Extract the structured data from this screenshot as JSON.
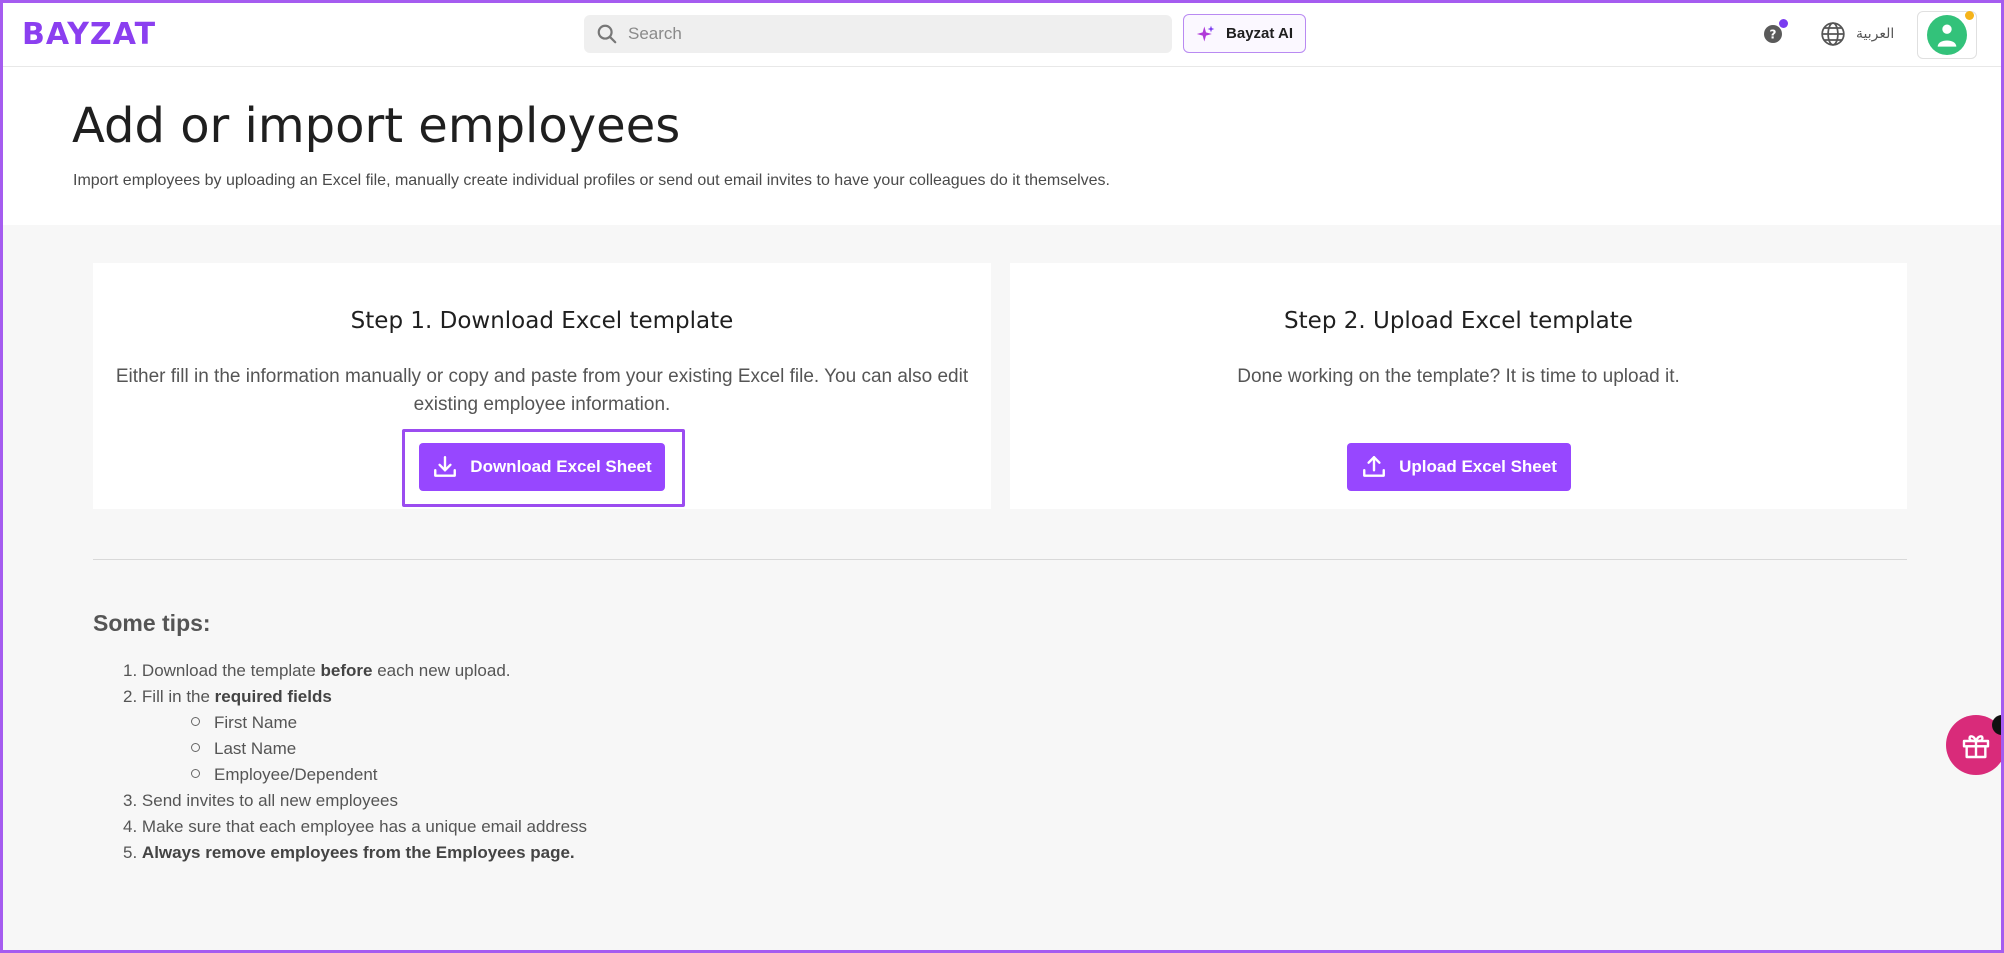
{
  "topbar": {
    "logo": "BAYZAT",
    "search_placeholder": "Search",
    "ai_button": "Bayzat AI",
    "language": "العربية"
  },
  "header": {
    "title": "Add or import employees",
    "subtitle": "Import employees by uploading an Excel file, manually create individual profiles or send out email invites to have your colleagues do it themselves."
  },
  "step1": {
    "title": "Step 1. Download Excel template",
    "description": "Either fill in the information manually or copy and paste from your existing Excel file. You can also edit existing employee information.",
    "button": "Download Excel Sheet"
  },
  "step2": {
    "title": "Step 2. Upload Excel template",
    "description": "Done working on the template? It is time to upload it.",
    "button": "Upload Excel Sheet"
  },
  "tips": {
    "title": "Some tips:",
    "t1_num": "1.",
    "t1_pre": "Download the template ",
    "t1_bold": "before",
    "t1_post": " each new upload.",
    "t2_num": "2.",
    "t2_pre": "Fill in the ",
    "t2_bold": "required fields",
    "fields": [
      "First Name",
      "Last Name",
      "Employee/Dependent"
    ],
    "t3_num": "3.",
    "t3": "Send invites to all new employees",
    "t4_num": "4.",
    "t4": "Make sure that each employee has a unique email address",
    "t5_num": "5.",
    "t5_bold": "Always remove employees from the Employees page."
  },
  "colors": {
    "brand": "#8b3ff0",
    "button": "#9747ff",
    "gift": "#d92b7a",
    "avatar": "#33c27a"
  },
  "icons": [
    "search-icon",
    "sparkle-icon",
    "help-icon",
    "globe-icon",
    "avatar-icon",
    "download-icon",
    "upload-icon",
    "gift-icon"
  ]
}
